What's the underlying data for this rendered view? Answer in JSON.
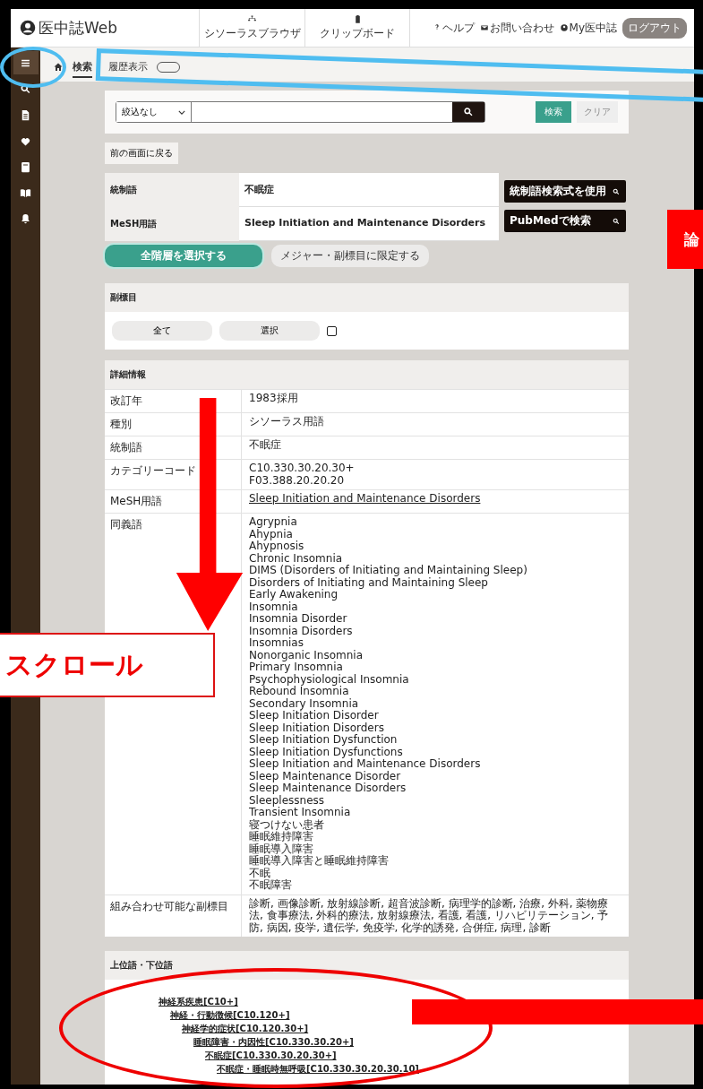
{
  "header": {
    "logo": "医中誌Web",
    "tools": [
      {
        "kind": "tree",
        "label": "シソーラスブラウザ"
      },
      {
        "kind": "clip",
        "label": "クリップボード"
      }
    ],
    "links": [
      {
        "kind": "help",
        "label": "ヘルプ"
      },
      {
        "kind": "mail",
        "label": "お問い合わせ"
      },
      {
        "kind": "user",
        "label": "My医中誌"
      }
    ],
    "logout": "ログアウト"
  },
  "sidebar": {
    "items": [
      {
        "kind": "menu",
        "selected": true
      },
      {
        "kind": "search",
        "selected": false
      },
      {
        "kind": "doc",
        "selected": false
      },
      {
        "kind": "heart",
        "selected": false
      },
      {
        "kind": "note",
        "selected": false
      },
      {
        "kind": "book",
        "selected": false
      },
      {
        "kind": "bell",
        "selected": false
      }
    ]
  },
  "tabs": [
    {
      "label": "検索",
      "selected": true
    },
    {
      "label": "履歴表示",
      "selected": false
    }
  ],
  "search": {
    "filter": "絞込なし",
    "submit": "検索",
    "clear": "クリア"
  },
  "back_button": "前の画面に戻る",
  "terms": [
    {
      "label": "統制語",
      "value": "不眠症",
      "action": "統制語検索式を使用"
    },
    {
      "label": "MeSH用語",
      "value": "Sleep Initiation and Maintenance Disorders",
      "action": "PubMedで検索"
    }
  ],
  "term_buttons": [
    {
      "label": "全階層を選択する",
      "selected": true
    },
    {
      "label": "メジャー・副標目に限定する",
      "selected": false
    }
  ],
  "subheadings": {
    "title": "副標目",
    "buttons": [
      "全て",
      "選択"
    ],
    "checked": false
  },
  "details": {
    "title": "詳細情報",
    "rows": [
      {
        "label": "改訂年",
        "lines": [
          "1983採用"
        ]
      },
      {
        "label": "種別",
        "lines": [
          "シソーラス用語"
        ]
      },
      {
        "label": "統制語",
        "lines": [
          "不眠症"
        ]
      },
      {
        "label": "カテゴリーコード",
        "lines": [
          "C10.330.30.20.30+",
          "F03.388.20.20.20"
        ]
      },
      {
        "label": "MeSH用語",
        "lines": [
          "Sleep Initiation and Maintenance Disorders"
        ],
        "link": true
      },
      {
        "label": "同義語",
        "lines": [
          "Agrypnia",
          "Ahypnia",
          "Ahypnosis",
          "Chronic Insomnia",
          "DIMS (Disorders of Initiating and Maintaining Sleep)",
          "Disorders of Initiating and Maintaining Sleep",
          "Early Awakening",
          "Insomnia",
          "Insomnia Disorder",
          "Insomnia Disorders",
          "Insomnias",
          "Nonorganic Insomnia",
          "Primary Insomnia",
          "Psychophysiological Insomnia",
          "Rebound Insomnia",
          "Secondary Insomnia",
          "Sleep Initiation Disorder",
          "Sleep Initiation Disorders",
          "Sleep Initiation Dysfunction",
          "Sleep Initiation Dysfunctions",
          "Sleep Initiation and Maintenance Disorders",
          "Sleep Maintenance Disorder",
          "Sleep Maintenance Disorders",
          "Sleeplessness",
          "Transient Insomnia",
          "寝つけない患者",
          "睡眠維持障害",
          "睡眠導入障害",
          "睡眠導入障害と睡眠維持障害",
          "不眠",
          "不眠障害"
        ]
      },
      {
        "label": "組み合わせ可能な副標目",
        "lines": [
          "診断, 画像診断, 放射線診断, 超音波診断, 病理学的診断, 治療, 外科, 薬物療法, 食事療法, 外科的療法, 放射線療法, 看護, 看護, リハビリテーション, 予防, 病因, 疫学, 遺伝学, 免疫学, 化学的誘発, 合併症, 病理, 診断"
        ]
      }
    ]
  },
  "hierarchy": {
    "title": "上位語・下位語",
    "items": [
      {
        "label": "神経系疾患[C10+]",
        "children": [
          {
            "label": "神経・行動徴候[C10.120+]",
            "children": [
              {
                "label": "神経学的症状[C10.120.30+]",
                "children": [
                  {
                    "label": "睡眠障害・内因性[C10.330.30.20+]",
                    "children": [
                      {
                        "label": "不眠症[C10.330.30.20.30+]",
                        "children": [
                          {
                            "label": "不眠症・睡眠時無呼吸[C10.330.30.20.30.10]"
                          }
                        ]
                      }
                    ]
                  }
                ]
              }
            ]
          }
        ]
      }
    ]
  },
  "annotations": [
    {
      "kind": "circle"
    },
    {
      "kind": "frame"
    },
    {
      "kind": "arrow"
    },
    {
      "kind": "callout",
      "text": "スクロール"
    },
    {
      "kind": "tag",
      "text": "論"
    },
    {
      "kind": "ellipse"
    },
    {
      "kind": "bar"
    }
  ]
}
